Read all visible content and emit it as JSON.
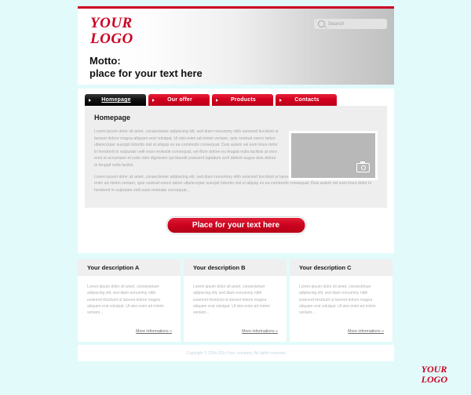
{
  "theme": {
    "background": "#e2fafa",
    "accent_red": "#cc0022",
    "panel_white": "#ffffff",
    "content_gray": "#eeeeee"
  },
  "header": {
    "logo_line1": "YOUR",
    "logo_line2": "LOGO",
    "motto_line1": "Motto:",
    "motto_line2": "place for your text here",
    "search": {
      "placeholder": "Search",
      "value": "",
      "icon": "search-icon"
    }
  },
  "nav": {
    "items": [
      {
        "label": "Homepage",
        "active": true
      },
      {
        "label": "Our offer",
        "active": false
      },
      {
        "label": "Products",
        "active": false
      },
      {
        "label": "Contacts",
        "active": false
      }
    ]
  },
  "content": {
    "title": "Homepage",
    "paragraph1": "Lorem ipsum dolor sit amet, consectetuer adipiscing elit, sed diam nonummy nibh euismod tincidunt ut laoreet dolore magna aliquam erat volutpat. Ut wisi enim ad minim veniam, quis nostrud exerci tation ullamcorper suscipit lobortis nisl ut aliquip ex ea commodo consequat. Duis autem vel eum iriure dolor in hendrerit in vulputate velit esse molestie consequat, vel illum dolore eu feugiat nulla facilisis at vero eros et accumsan et iusto odio dignissim qui blandit praesent luptatum zzril delenit augue duis dolore te feugait nulla facilisi.",
    "paragraph2": "Lorem ipsum dolor sit amet, consectetuer adipiscing elit, sed diam nonummy nibh euismod tincidunt ut laoreet dolore magna aliquam erat volutpat. Ut wisi enim ad minim veniam, quis nostrud exerci tation ullamcorper suscipit lobortis nisl ut aliquip ex ea commodo consequat. Duis autem vel eum iriure dolor in hendrerit in vulputate velit esse molestie consequat...",
    "image_placeholder_icon": "camera-icon"
  },
  "cta": {
    "label": "Place for your text here"
  },
  "columns": [
    {
      "title": "Your description A",
      "text": "Lorem ipsum dolor sit amet, consectetuer adipiscing elit, sed diam nonummy nibh euismod tincidunt ut laoreet dolore magna aliquam erat volutpat. Ut wisi enim ad minim veniam...",
      "link": "More informations »"
    },
    {
      "title": "Your description B",
      "text": "Lorem ipsum dolor sit amet, consectetuer adipiscing elit, sed diam nonummy nibh euismod tincidunt ut laoreet dolore magna aliquam erat volutpat. Ut wisi enim ad minim veniam...",
      "link": "More informations »"
    },
    {
      "title": "Your description C",
      "text": "Lorem ipsum dolor sit amet, consectetuer adipiscing elit, sed diam nonummy nibh euismod tincidunt ut laoreet dolore magna aliquam erat volutpat. Ut wisi enim ad minim veniam...",
      "link": "More informations »"
    }
  ],
  "footer": {
    "copyright": "Copyright © 200x-201x Your company.  All rights reserved",
    "logo_line1": "YOUR",
    "logo_line2": "LOGO"
  }
}
